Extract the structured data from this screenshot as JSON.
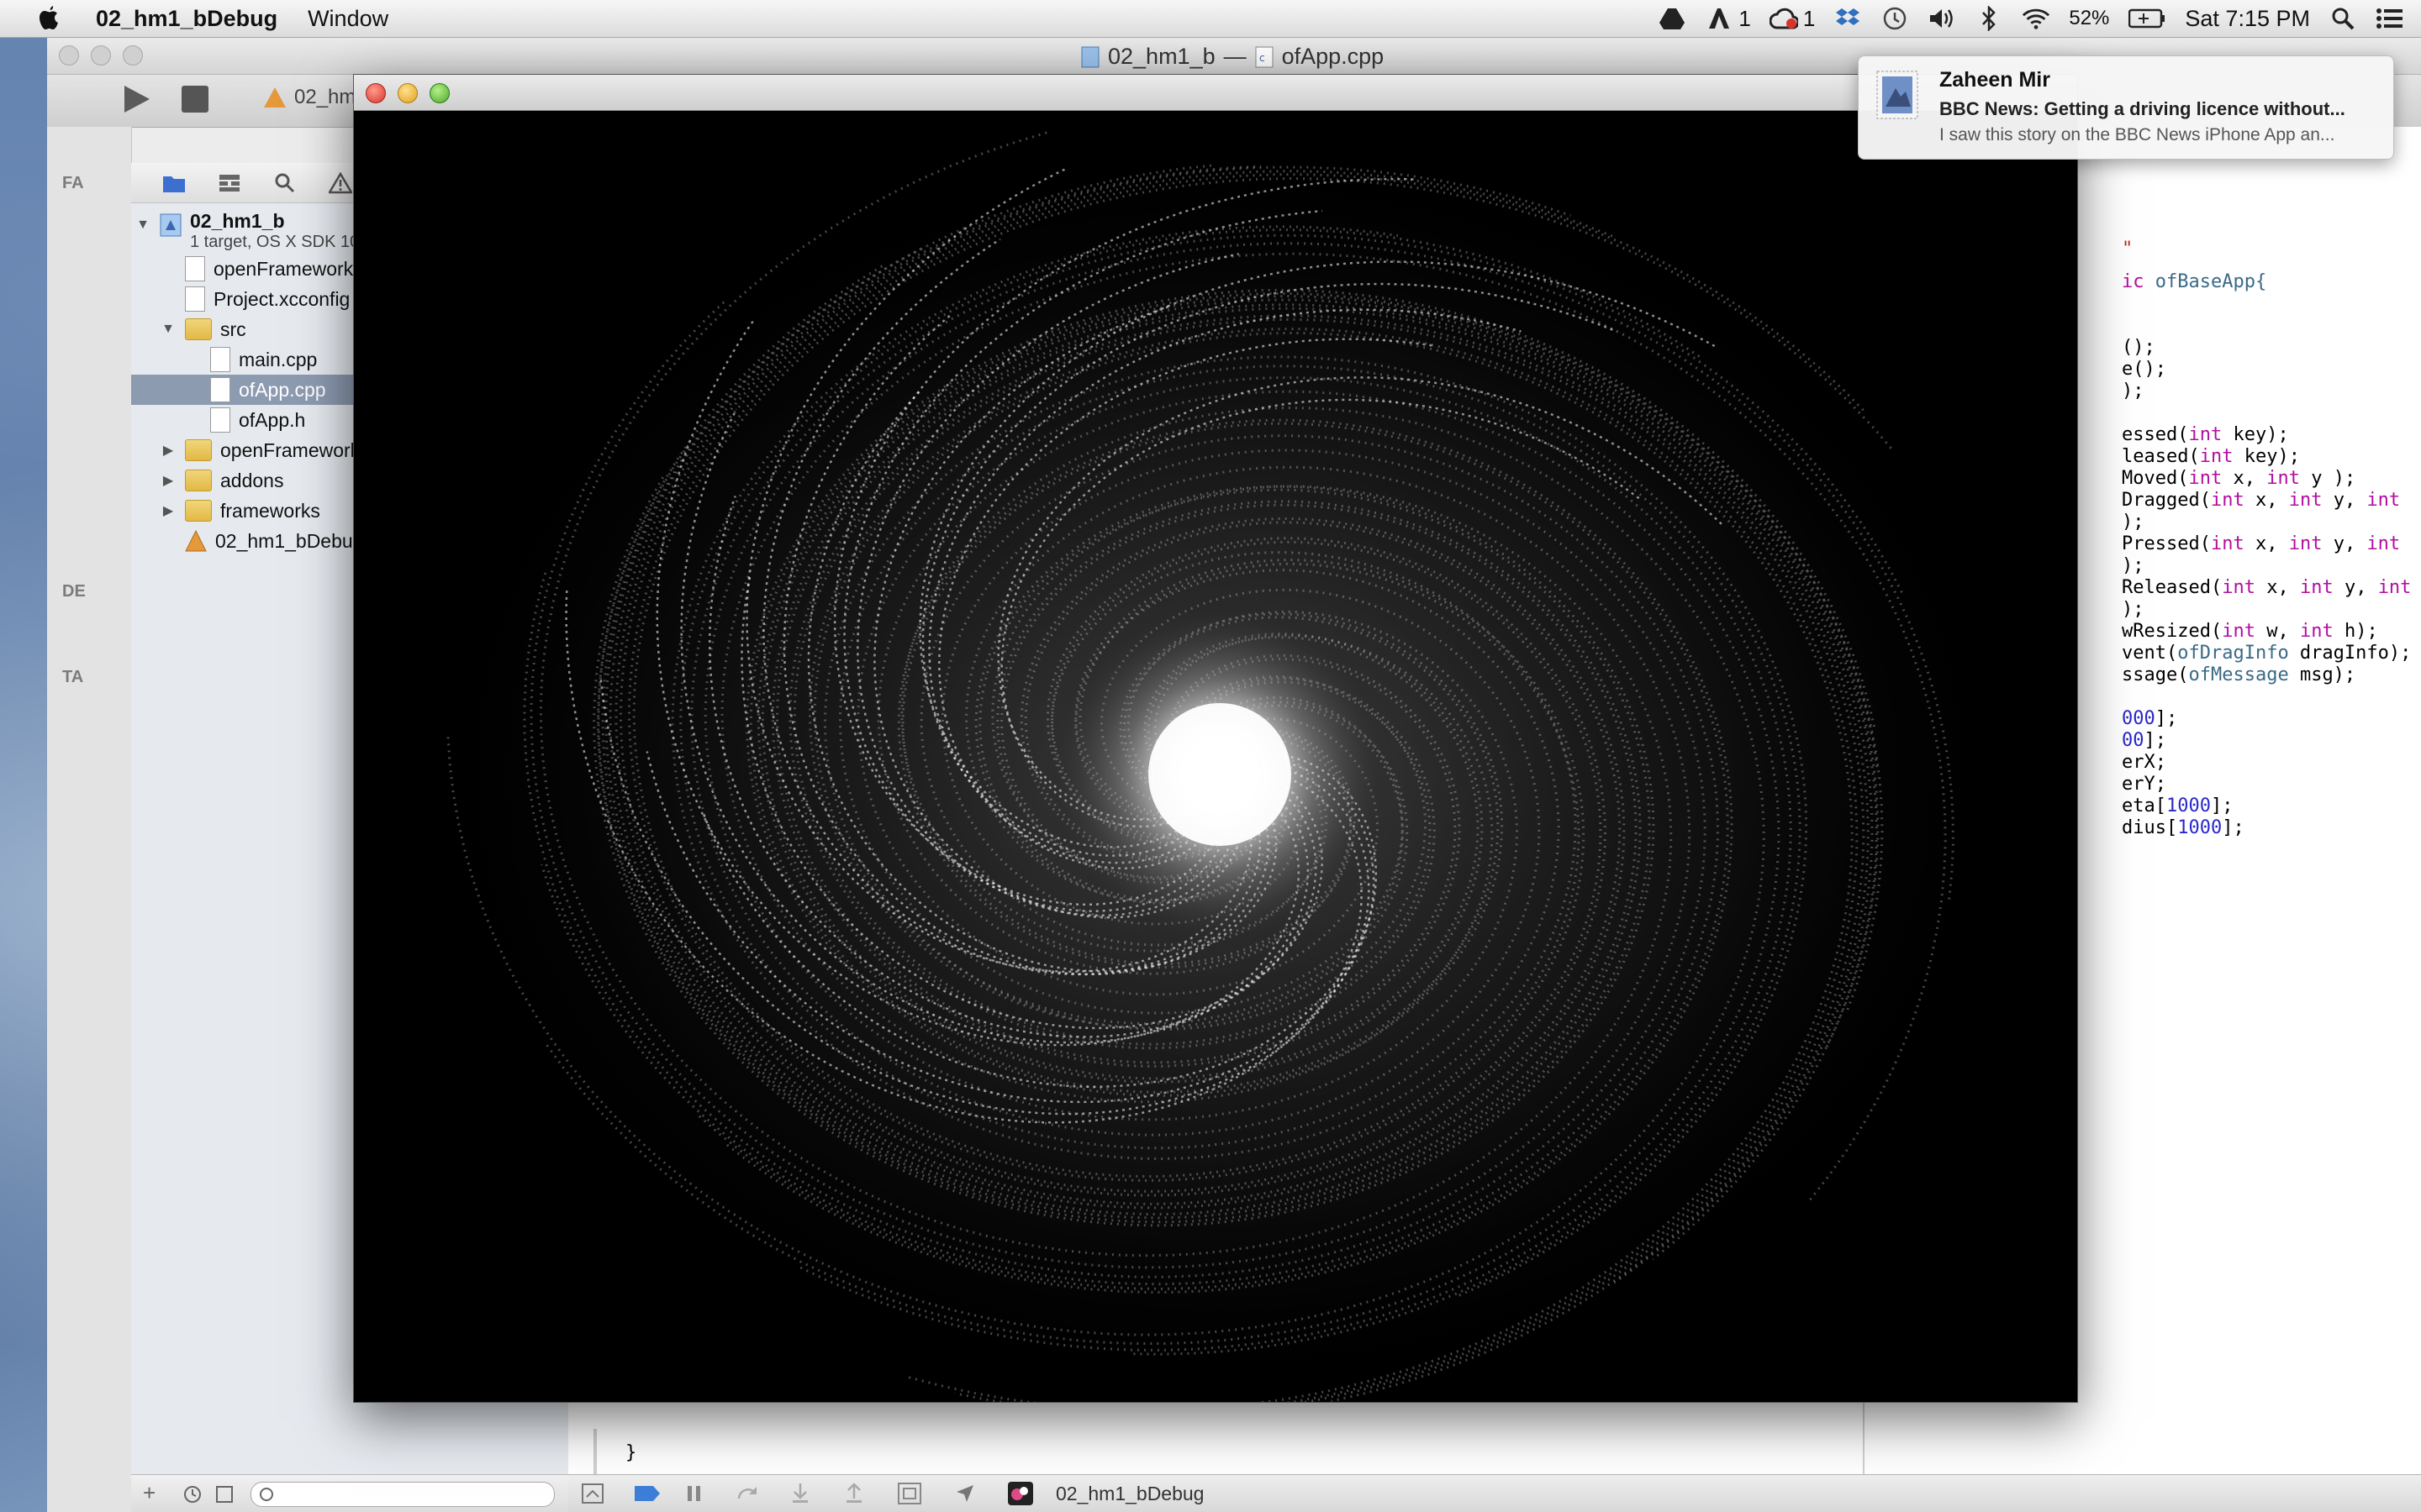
{
  "menubar": {
    "app_name": "02_hm1_bDebug",
    "menu_window": "Window",
    "notif_count_a": "1",
    "notif_count_b": "1",
    "battery": "52%",
    "clock": "Sat 7:15 PM"
  },
  "xcode": {
    "window_title_project": "02_hm1_b",
    "window_title_sep": "—",
    "window_title_file": "ofApp.cpp",
    "scheme_label": "02_hm",
    "strip_labels": [
      "FA",
      "DE",
      "TA"
    ]
  },
  "navigator": {
    "project": {
      "name": "02_hm1_b",
      "subtitle": "1 target, OS X SDK 10.9"
    },
    "items": [
      {
        "label": "openFrameworks-Inf",
        "kind": "plist"
      },
      {
        "label": "Project.xcconfig",
        "kind": "config"
      },
      {
        "label": "src",
        "kind": "folder"
      },
      {
        "label": "main.cpp",
        "kind": "cpp"
      },
      {
        "label": "ofApp.cpp",
        "kind": "cpp"
      },
      {
        "label": "ofApp.h",
        "kind": "h"
      },
      {
        "label": "openFrameworks",
        "kind": "folder"
      },
      {
        "label": "addons",
        "kind": "folder"
      },
      {
        "label": "frameworks",
        "kind": "folder"
      },
      {
        "label": "02_hm1_bDebug.app",
        "kind": "app"
      }
    ],
    "selected": "ofApp.cpp"
  },
  "code_lines": {
    "l1": "\"",
    "l2a": "ic ",
    "l2b": "ofBaseApp{",
    "l3": "();",
    "l4": "e();",
    "l5": ");",
    "l6a": "essed(",
    "l6b": "int",
    "l6c": " key);",
    "l7a": "leased(",
    "l7b": "int",
    "l7c": " key);",
    "l8a": "Moved(",
    "l8b": "int",
    "l8c": " x, ",
    "l8d": "int",
    "l8e": " y );",
    "l9a": "Dragged(",
    "l9b": "int",
    "l9c": " x, ",
    "l9d": "int",
    "l9e": " y, ",
    "l9f": "int",
    "l10": ");",
    "l11a": "Pressed(",
    "l11b": "int",
    "l11c": " x, ",
    "l11d": "int",
    "l11e": " y, ",
    "l11f": "int",
    "l12": ");",
    "l13a": "Released(",
    "l13b": "int",
    "l13c": " x, ",
    "l13d": "int",
    "l13e": " y, ",
    "l13f": "int",
    "l14": ");",
    "l15a": "wResized(",
    "l15b": "int",
    "l15c": " w, ",
    "l15d": "int",
    "l15e": " h);",
    "l16a": "vent(",
    "l16b": "ofDragInfo",
    "l16c": " dragInfo);",
    "l17a": "ssage(",
    "l17b": "ofMessage",
    "l17c": " msg);",
    "l18a": "000",
    "l18b": "];",
    "l19a": "00",
    "l19b": "];",
    "l20": "erX;",
    "l21": "erY;",
    "l22a": "eta[",
    "l22b": "1000",
    "l22c": "];",
    "l23a": "dius[",
    "l23b": "1000",
    "l23c": "];",
    "brace": "}",
    "comment": "//--------------------------------------------------------------"
  },
  "debug_bar": {
    "target_label": "02_hm1_bDebug"
  },
  "notification": {
    "title": "Zaheen Mir",
    "subtitle": "BBC News: Getting a driving licence without...",
    "body": "I saw this story on the BBC News iPhone App an..."
  },
  "colors": {
    "keyword": "#b30e9f",
    "number": "#2a27c9",
    "class": "#3a6a86",
    "comment": "#117a18",
    "selection": "#8d9bb1"
  }
}
